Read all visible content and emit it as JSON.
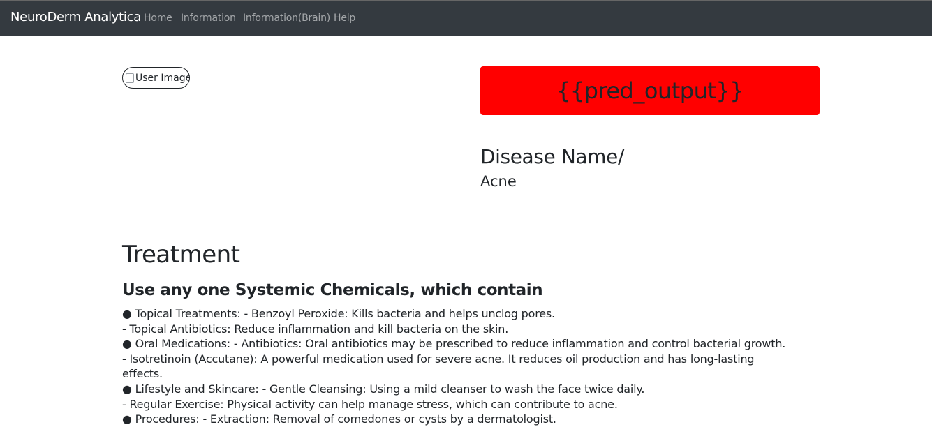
{
  "navbar": {
    "brand": "NeuroDerm Analytica",
    "links": [
      "Home",
      "Information",
      "Information(Brain)",
      "Help"
    ]
  },
  "image": {
    "alt_text": "User Image"
  },
  "prediction": {
    "output": "{{pred_output}}",
    "bg_color": "#ff0000"
  },
  "disease": {
    "heading": "Disease Name/",
    "name": "Acne"
  },
  "treatment": {
    "heading": "Treatment",
    "subheading": "Use any one Systemic Chemicals, which contain",
    "lines": [
      "● Topical Treatments: - Benzoyl Peroxide: Kills bacteria and helps unclog pores.",
      "- Topical Antibiotics: Reduce inflammation and kill bacteria on the skin.",
      "● Oral Medications: - Antibiotics: Oral antibiotics may be prescribed to reduce inflammation and control bacterial growth.",
      "- Isotretinoin (Accutane): A powerful medication used for severe acne. It reduces oil production and has long-lasting",
      "effects.",
      "● Lifestyle and Skincare: - Gentle Cleansing: Using a mild cleanser to wash the face twice daily.",
      "- Regular Exercise: Physical activity can help manage stress, which can contribute to acne.",
      "● Procedures: - Extraction: Removal of comedones or cysts by a dermatologist."
    ]
  }
}
